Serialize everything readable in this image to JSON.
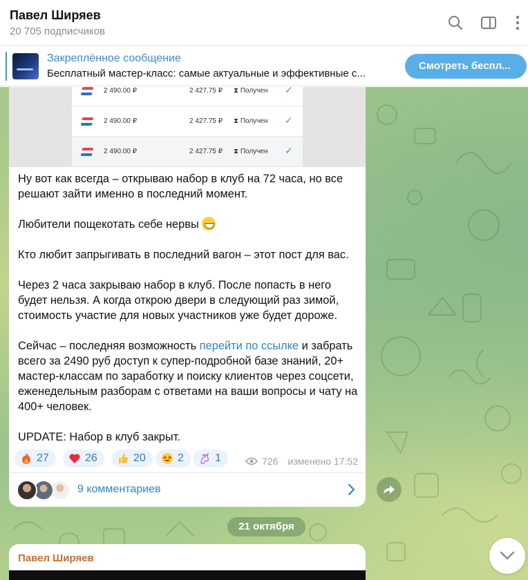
{
  "header": {
    "channel_name": "Павел Ширяев",
    "subscribers": "20 705 подписчиков"
  },
  "pinned": {
    "title": "Закреплённое сообщение",
    "text": "Бесплатный мастер-класс: самые актуальные и эффективные с...",
    "button_label": "Смотреть беспл..."
  },
  "payments": [
    {
      "amount": "2 490.00 ₽",
      "net": "2 427.75 ₽",
      "status": "Получен"
    },
    {
      "amount": "2 490.00 ₽",
      "net": "2 427.75 ₽",
      "status": "Получен"
    },
    {
      "amount": "2 490.00 ₽",
      "net": "2 427.75 ₽",
      "status": "Получен"
    }
  ],
  "message": {
    "p1": "Ну вот как всегда – открываю набор в клуб на 72 часа, но все решают зайти именно в последний момент.",
    "p2": "Любители пощекотать себе нервы",
    "p3": "Кто любит запрыгивать в последний вагон – этот пост для вас.",
    "p4": "Через 2 часа закрываю набор в клуб. После попасть в него будет нельзя. А когда открою двери в следующий раз зимой, стоимость участие для новых участников уже будет дороже.",
    "p5_before": "Сейчас – последняя возможность ",
    "p5_link": "перейти по ссылке",
    "p5_after": " и забрать всего за 2490 руб доступ к супер-подробной базе знаний, 20+ мастер-классам по заработку и поиску клиентов через соцсети, еженедельным разборам с ответами на ваши вопросы и чату на 400+ человек.",
    "p6": "UPDATE: Набор в клуб закрыт.",
    "views": "726",
    "edited": "изменено 17:52",
    "comments": "9 комментариев"
  },
  "reactions": [
    {
      "icon": "fire-icon",
      "count": "27"
    },
    {
      "icon": "heart-icon",
      "count": "26"
    },
    {
      "icon": "thumbs-up-icon",
      "count": "20"
    },
    {
      "icon": "star-struck-icon",
      "count": "2"
    },
    {
      "icon": "unicorn-icon",
      "count": "1"
    }
  ],
  "date_separator": "21 октября",
  "next_message": {
    "author": "Павел Ширяев"
  },
  "colors": {
    "accent": "#3a8dcf",
    "button": "#5aaee8",
    "reaction_bg": "#eaf3fb",
    "author": "#c9702e"
  }
}
